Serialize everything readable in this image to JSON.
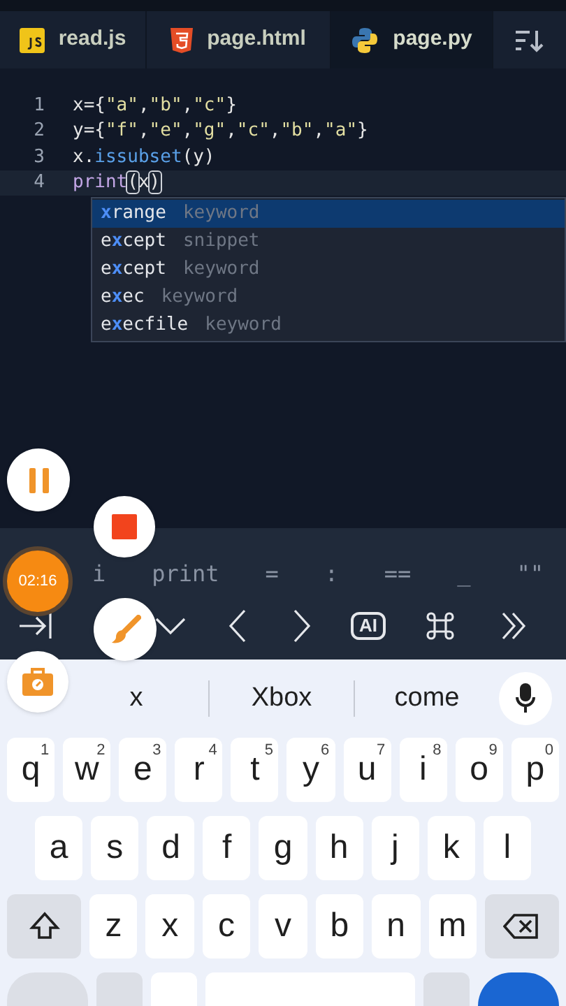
{
  "tabs": [
    {
      "label": "read.js",
      "kind": "js",
      "selected": false
    },
    {
      "label": "page.html",
      "kind": "html",
      "selected": false
    },
    {
      "label": "page.py",
      "kind": "py",
      "selected": true
    }
  ],
  "code_lines": [
    {
      "number": "1",
      "current": false,
      "tokens": [
        {
          "text": "x={",
          "kind": "plain"
        },
        {
          "text": "\"a\"",
          "kind": "string"
        },
        {
          "text": ",",
          "kind": "plain"
        },
        {
          "text": "\"b\"",
          "kind": "string"
        },
        {
          "text": ",",
          "kind": "plain"
        },
        {
          "text": "\"c\"",
          "kind": "string"
        },
        {
          "text": "}",
          "kind": "plain"
        }
      ]
    },
    {
      "number": "2",
      "current": false,
      "tokens": [
        {
          "text": "y={",
          "kind": "plain"
        },
        {
          "text": "\"f\"",
          "kind": "string"
        },
        {
          "text": ",",
          "kind": "plain"
        },
        {
          "text": "\"e\"",
          "kind": "string"
        },
        {
          "text": ",",
          "kind": "plain"
        },
        {
          "text": "\"g\"",
          "kind": "string"
        },
        {
          "text": ",",
          "kind": "plain"
        },
        {
          "text": "\"c\"",
          "kind": "string"
        },
        {
          "text": ",",
          "kind": "plain"
        },
        {
          "text": "\"b\"",
          "kind": "string"
        },
        {
          "text": ",",
          "kind": "plain"
        },
        {
          "text": "\"a\"",
          "kind": "string"
        },
        {
          "text": "}",
          "kind": "plain"
        }
      ]
    },
    {
      "number": "3",
      "current": false,
      "tokens": [
        {
          "text": "x.",
          "kind": "plain"
        },
        {
          "text": "issubset",
          "kind": "method"
        },
        {
          "text": "(y)",
          "kind": "plain"
        }
      ]
    },
    {
      "number": "4",
      "current": true,
      "tokens": [
        {
          "text": "print",
          "kind": "builtin"
        },
        {
          "text": "(",
          "kind": "bracket"
        },
        {
          "text": "x",
          "kind": "plain"
        },
        {
          "text": ")",
          "kind": "bracket"
        }
      ]
    }
  ],
  "completions": [
    {
      "match": "x",
      "after": "range",
      "type": "keyword",
      "selected": true
    },
    {
      "before": "e",
      "match": "x",
      "after": "cept",
      "type": "snippet",
      "selected": false
    },
    {
      "before": "e",
      "match": "x",
      "after": "cept",
      "type": "keyword",
      "selected": false
    },
    {
      "before": "e",
      "match": "x",
      "after": "ec",
      "type": "keyword",
      "selected": false
    },
    {
      "before": "e",
      "match": "x",
      "after": "ecfile",
      "type": "keyword",
      "selected": false
    }
  ],
  "extra_keys": [
    "i",
    "print",
    "=",
    ":",
    "==",
    "_",
    "\"\""
  ],
  "tool_keys": [
    {
      "kind": "tab"
    },
    {
      "kind": "down"
    },
    {
      "kind": "left"
    },
    {
      "kind": "right"
    },
    {
      "kind": "ai",
      "label": "AI"
    },
    {
      "kind": "command"
    },
    {
      "kind": "more"
    }
  ],
  "recorder": {
    "timer": "02:16"
  },
  "suggestions": [
    "x",
    "Xbox",
    "come"
  ],
  "keyboard_rows": [
    [
      {
        "key": "q",
        "hint": "1"
      },
      {
        "key": "w",
        "hint": "2"
      },
      {
        "key": "e",
        "hint": "3"
      },
      {
        "key": "r",
        "hint": "4"
      },
      {
        "key": "t",
        "hint": "5"
      },
      {
        "key": "y",
        "hint": "6"
      },
      {
        "key": "u",
        "hint": "7"
      },
      {
        "key": "i",
        "hint": "8"
      },
      {
        "key": "o",
        "hint": "9"
      },
      {
        "key": "p",
        "hint": "0"
      }
    ],
    [
      {
        "key": "a"
      },
      {
        "key": "s"
      },
      {
        "key": "d"
      },
      {
        "key": "f"
      },
      {
        "key": "g"
      },
      {
        "key": "h"
      },
      {
        "key": "j"
      },
      {
        "key": "k"
      },
      {
        "key": "l"
      }
    ],
    [
      {
        "kind": "shift"
      },
      {
        "key": "z"
      },
      {
        "key": "x"
      },
      {
        "key": "c"
      },
      {
        "key": "v"
      },
      {
        "key": "b"
      },
      {
        "key": "n"
      },
      {
        "key": "m"
      },
      {
        "kind": "backspace"
      }
    ]
  ]
}
